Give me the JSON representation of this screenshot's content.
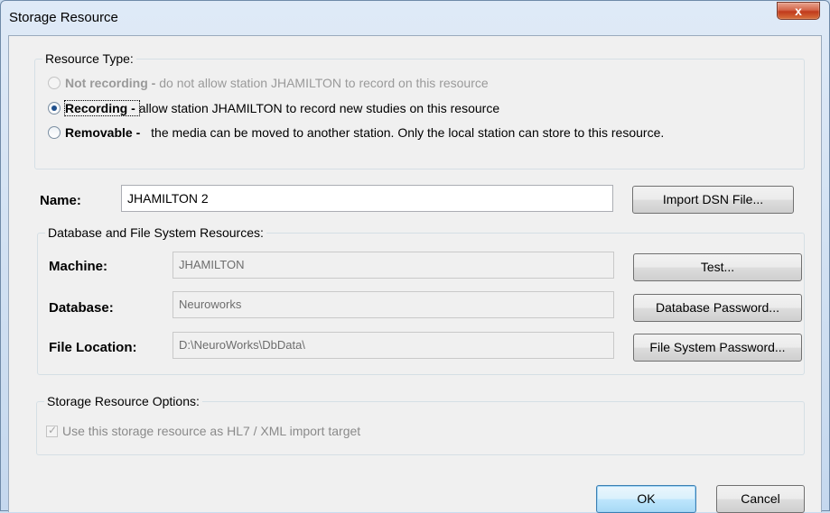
{
  "window": {
    "title": "Storage Resource",
    "close_glyph": "x"
  },
  "resource_type": {
    "legend": "Resource Type:",
    "options": [
      {
        "label": "Not recording",
        "sep": " - ",
        "desc": "do not allow station JHAMILTON to record on this resource",
        "checked": false,
        "disabled": true
      },
      {
        "label": "Recording",
        "sep": " - ",
        "desc": "allow station JHAMILTON to record new studies on this resource",
        "checked": true,
        "disabled": false
      },
      {
        "label": "Removable",
        "sep": " - ",
        "desc": "the media can be moved to another station.  Only the local station can store to this resource.",
        "checked": false,
        "disabled": false
      }
    ]
  },
  "name": {
    "label": "Name:",
    "value": "JHAMILTON 2",
    "import_button": "Import DSN File..."
  },
  "db_resources": {
    "legend": "Database and File System Resources:",
    "machine_label": "Machine:",
    "machine_value": "JHAMILTON",
    "test_button": "Test...",
    "database_label": "Database:",
    "database_value": "Neuroworks",
    "db_password_button": "Database Password...",
    "file_location_label": "File Location:",
    "file_location_value": "D:\\NeuroWorks\\DbData\\",
    "fs_password_button": "File System Password..."
  },
  "options": {
    "legend": "Storage Resource Options:",
    "hl7_checkbox_label": "Use this storage resource as HL7 / XML import target",
    "hl7_checked": true,
    "hl7_disabled": true
  },
  "footer": {
    "ok_button": "OK",
    "cancel_button": "Cancel"
  }
}
